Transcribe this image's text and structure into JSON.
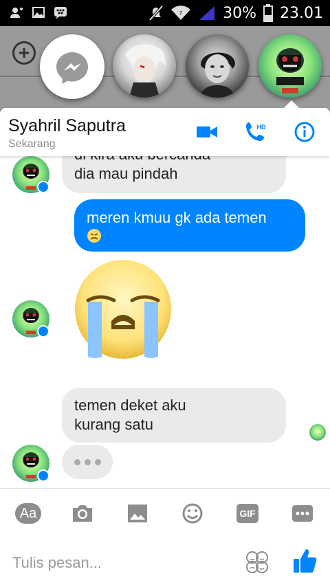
{
  "status_bar": {
    "battery_percent": "30%",
    "time": "23.01",
    "icons": [
      "add-contact-icon",
      "image-icon",
      "bbm-icon",
      "mute-icon",
      "wifi-icon",
      "signal-icon",
      "battery-icon"
    ]
  },
  "chat_heads": {
    "items": [
      "messenger-head",
      "contact-head-1",
      "contact-head-2",
      "contact-head-active"
    ]
  },
  "header": {
    "contact_name": "Syahril Saputra",
    "presence": "Sekarang",
    "video_icon": "video-call-icon",
    "call_icon": "hd-call-icon",
    "call_badge": "HD",
    "info_icon": "info-icon"
  },
  "messages": [
    {
      "direction": "in",
      "lines": [
        "di kira aku bercanda",
        "dia mau pindah"
      ]
    },
    {
      "direction": "out",
      "lines": [
        "meren kmuu gk ada temen"
      ],
      "emoji": "disappointed-face"
    },
    {
      "direction": "in",
      "sticker": "crying-face-sticker"
    },
    {
      "direction": "in",
      "lines": [
        "temen deket aku",
        "kurang satu"
      ]
    }
  ],
  "typing_indicator": "•••",
  "toolbar": {
    "text_button_label": "Aa",
    "gif_button_label": "GIF",
    "icons": [
      "text-format-icon",
      "camera-icon",
      "gallery-icon",
      "emoji-icon",
      "gif-icon",
      "more-icon"
    ]
  },
  "composer": {
    "placeholder": "Tulis pesan...",
    "value": ""
  },
  "colors": {
    "accent": "#0084ff",
    "incoming_bubble": "#eaeaea",
    "outgoing_bubble": "#0084ff"
  }
}
